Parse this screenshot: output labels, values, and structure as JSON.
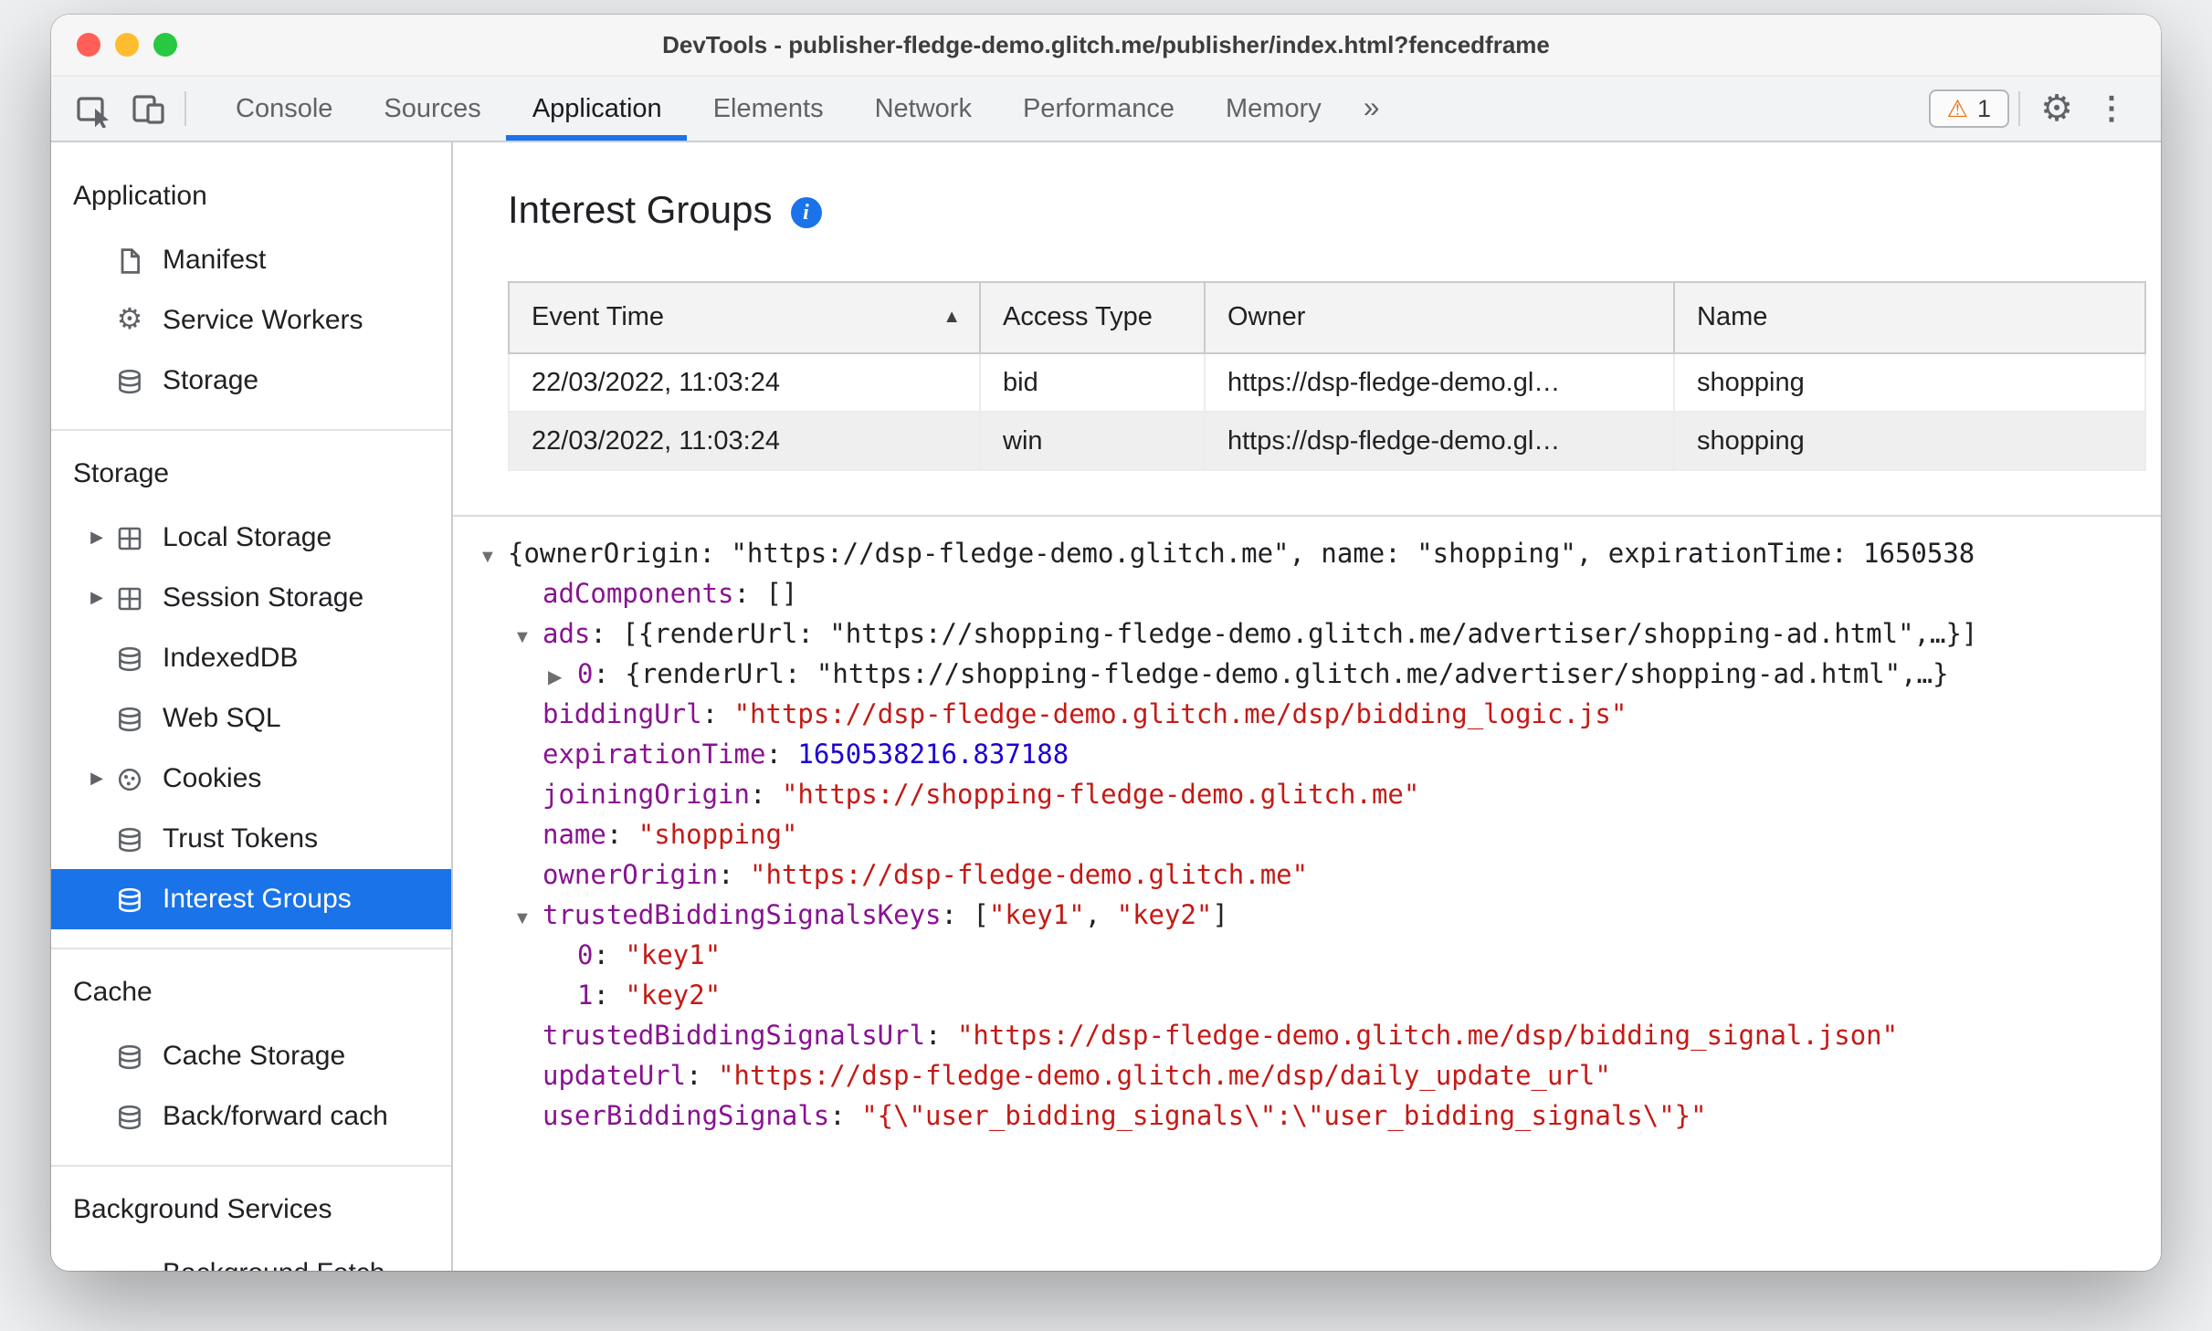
{
  "window": {
    "title": "DevTools - publisher-fledge-demo.glitch.me/publisher/index.html?fencedframe"
  },
  "glyphs": {
    "expander_collapsed": "▶",
    "expander_expanded": "▼",
    "sort_ascending": "▲",
    "more_tabs": "»",
    "warning": "⚠",
    "gear": "⚙",
    "kebab": "⋮",
    "info": "i"
  },
  "colors": {
    "accent": "#1a73e8",
    "selected_background": "#1a73e8",
    "property_key": "#881391",
    "string_value": "#c41a16",
    "number_value": "#1c00cf",
    "warning": "#e8710a"
  },
  "toolbar": {
    "tabs": [
      {
        "label": "Console",
        "active": false
      },
      {
        "label": "Sources",
        "active": false
      },
      {
        "label": "Application",
        "active": true
      },
      {
        "label": "Elements",
        "active": false
      },
      {
        "label": "Network",
        "active": false
      },
      {
        "label": "Performance",
        "active": false
      },
      {
        "label": "Memory",
        "active": false
      }
    ],
    "warning_count": "1"
  },
  "sidebar": {
    "sections": [
      {
        "title": "Application",
        "items": [
          {
            "label": "Manifest",
            "icon": "file"
          },
          {
            "label": "Service Workers",
            "icon": "gear"
          },
          {
            "label": "Storage",
            "icon": "database"
          }
        ]
      },
      {
        "title": "Storage",
        "items": [
          {
            "label": "Local Storage",
            "icon": "table",
            "expandable": true
          },
          {
            "label": "Session Storage",
            "icon": "table",
            "expandable": true
          },
          {
            "label": "IndexedDB",
            "icon": "database"
          },
          {
            "label": "Web SQL",
            "icon": "database"
          },
          {
            "label": "Cookies",
            "icon": "cookie",
            "expandable": true
          },
          {
            "label": "Trust Tokens",
            "icon": "database"
          },
          {
            "label": "Interest Groups",
            "icon": "database",
            "selected": true
          }
        ]
      },
      {
        "title": "Cache",
        "items": [
          {
            "label": "Cache Storage",
            "icon": "database"
          },
          {
            "label": "Back/forward cach",
            "icon": "database"
          }
        ]
      },
      {
        "title": "Background Services",
        "items": [
          {
            "label": "Background Fetch",
            "icon": "fetch"
          }
        ]
      }
    ]
  },
  "main": {
    "title": "Interest Groups",
    "table": {
      "columns": [
        "Event Time",
        "Access Type",
        "Owner",
        "Name"
      ],
      "sort": {
        "column": "Event Time",
        "direction": "ascending"
      },
      "rows": [
        [
          "22/03/2022, 11:03:24",
          "bid",
          "https://dsp-fledge-demo.gl…",
          "shopping"
        ],
        [
          "22/03/2022, 11:03:24",
          "win",
          "https://dsp-fledge-demo.gl…",
          "shopping"
        ]
      ]
    },
    "tree": {
      "lines": [
        {
          "indent": 0,
          "arrow": "▼",
          "segments": [
            {
              "type": "plain",
              "text": "{ownerOrigin: \"https://dsp-fledge-demo.glitch.me\", name: \"shopping\", expirationTime: 1650538"
            }
          ]
        },
        {
          "indent": 1,
          "arrow": "",
          "segments": [
            {
              "type": "key",
              "text": "adComponents"
            },
            {
              "type": "plain",
              "text": ": []"
            }
          ]
        },
        {
          "indent": 1,
          "arrow": "▼",
          "segments": [
            {
              "type": "key",
              "text": "ads"
            },
            {
              "type": "plain",
              "text": ": [{renderUrl: \"https://shopping-fledge-demo.glitch.me/advertiser/shopping-ad.html\",…}]"
            }
          ]
        },
        {
          "indent": 2,
          "arrow": "▶",
          "segments": [
            {
              "type": "key",
              "text": "0"
            },
            {
              "type": "plain",
              "text": ": {renderUrl: \"https://shopping-fledge-demo.glitch.me/advertiser/shopping-ad.html\",…}"
            }
          ]
        },
        {
          "indent": 1,
          "arrow": "",
          "segments": [
            {
              "type": "key",
              "text": "biddingUrl"
            },
            {
              "type": "plain",
              "text": ": "
            },
            {
              "type": "string",
              "text": "\"https://dsp-fledge-demo.glitch.me/dsp/bidding_logic.js\""
            }
          ]
        },
        {
          "indent": 1,
          "arrow": "",
          "segments": [
            {
              "type": "key",
              "text": "expirationTime"
            },
            {
              "type": "plain",
              "text": ": "
            },
            {
              "type": "number",
              "text": "1650538216.837188"
            }
          ]
        },
        {
          "indent": 1,
          "arrow": "",
          "segments": [
            {
              "type": "key",
              "text": "joiningOrigin"
            },
            {
              "type": "plain",
              "text": ": "
            },
            {
              "type": "string",
              "text": "\"https://shopping-fledge-demo.glitch.me\""
            }
          ]
        },
        {
          "indent": 1,
          "arrow": "",
          "segments": [
            {
              "type": "key",
              "text": "name"
            },
            {
              "type": "plain",
              "text": ": "
            },
            {
              "type": "string",
              "text": "\"shopping\""
            }
          ]
        },
        {
          "indent": 1,
          "arrow": "",
          "segments": [
            {
              "type": "key",
              "text": "ownerOrigin"
            },
            {
              "type": "plain",
              "text": ": "
            },
            {
              "type": "string",
              "text": "\"https://dsp-fledge-demo.glitch.me\""
            }
          ]
        },
        {
          "indent": 1,
          "arrow": "▼",
          "segments": [
            {
              "type": "key",
              "text": "trustedBiddingSignalsKeys"
            },
            {
              "type": "plain",
              "text": ": ["
            },
            {
              "type": "string",
              "text": "\"key1\""
            },
            {
              "type": "plain",
              "text": ", "
            },
            {
              "type": "string",
              "text": "\"key2\""
            },
            {
              "type": "plain",
              "text": "]"
            }
          ]
        },
        {
          "indent": 2,
          "arrow": "",
          "segments": [
            {
              "type": "key",
              "text": "0"
            },
            {
              "type": "plain",
              "text": ": "
            },
            {
              "type": "string",
              "text": "\"key1\""
            }
          ]
        },
        {
          "indent": 2,
          "arrow": "",
          "segments": [
            {
              "type": "key",
              "text": "1"
            },
            {
              "type": "plain",
              "text": ": "
            },
            {
              "type": "string",
              "text": "\"key2\""
            }
          ]
        },
        {
          "indent": 1,
          "arrow": "",
          "segments": [
            {
              "type": "key",
              "text": "trustedBiddingSignalsUrl"
            },
            {
              "type": "plain",
              "text": ": "
            },
            {
              "type": "string",
              "text": "\"https://dsp-fledge-demo.glitch.me/dsp/bidding_signal.json\""
            }
          ]
        },
        {
          "indent": 1,
          "arrow": "",
          "segments": [
            {
              "type": "key",
              "text": "updateUrl"
            },
            {
              "type": "plain",
              "text": ": "
            },
            {
              "type": "string",
              "text": "\"https://dsp-fledge-demo.glitch.me/dsp/daily_update_url\""
            }
          ]
        },
        {
          "indent": 1,
          "arrow": "",
          "segments": [
            {
              "type": "key",
              "text": "userBiddingSignals"
            },
            {
              "type": "plain",
              "text": ": "
            },
            {
              "type": "string",
              "text": "\"{\\\"user_bidding_signals\\\":\\\"user_bidding_signals\\\"}\""
            }
          ]
        }
      ]
    }
  }
}
